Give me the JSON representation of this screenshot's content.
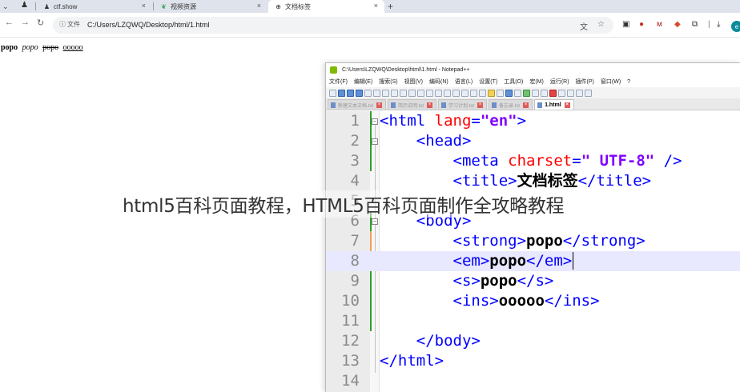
{
  "browser": {
    "tabs": [
      {
        "label": "ctf.show",
        "icon": "user-icon"
      },
      {
        "label": "视频资源",
        "icon": "leaf-icon"
      },
      {
        "label": "文档标签",
        "icon": "globe-icon",
        "active": true
      }
    ],
    "close_glyph": "×",
    "new_tab_glyph": "+",
    "info_chip_label": "文件",
    "url": "C:/Users/LZQWQ/Desktop/html/1.html",
    "avatar_letter": "e"
  },
  "page": {
    "strong_text": "popo",
    "em_text": "popo",
    "s_text": "popo",
    "ins_text": "ooooo"
  },
  "notepad": {
    "title": "C:\\Users\\LZQWQ\\Desktop\\html\\1.html - Notepad++",
    "menu": [
      "文件(F)",
      "编辑(E)",
      "搜索(S)",
      "视图(V)",
      "编码(N)",
      "语言(L)",
      "设置(T)",
      "工具(O)",
      "宏(M)",
      "运行(R)",
      "插件(P)",
      "窗口(W)",
      "?"
    ],
    "file_tabs": [
      {
        "label": "新建文本文档.txt"
      },
      {
        "label": "简历说明.txt"
      },
      {
        "label": "学习计划.txt"
      },
      {
        "label": "备忘录.txt"
      },
      {
        "label": "1.html",
        "active": true
      }
    ],
    "line_numbers": [
      "1",
      "2",
      "3",
      "4",
      "5",
      "6",
      "7",
      "8",
      "9",
      "10",
      "11",
      "12",
      "13",
      "14"
    ],
    "code": {
      "l1_open": "<html ",
      "l1_attr": "lang",
      "l1_eq": "=",
      "l1_val": "\"en\"",
      "l1_close": ">",
      "l2": "<head>",
      "l3_open": "<meta ",
      "l3_attr": "charset",
      "l3_eq": "=",
      "l3_val": "\" UTF-8\"",
      "l3_close": " />",
      "l4_open": "<title>",
      "l4_text": "文档标签",
      "l4_close": "</title>",
      "l6": "<body>",
      "l7_open": "<strong>",
      "l7_text": "popo",
      "l7_close": "</strong>",
      "l8_open": "<em>",
      "l8_text": "popo",
      "l8_close": "</em>",
      "l9_open": "<s>",
      "l9_text": "popo",
      "l9_close": "</s>",
      "l10_open": "<ins>",
      "l10_text": "ooooo",
      "l10_close": "</ins>",
      "l12": "</body>",
      "l13": "</html>"
    }
  },
  "watermark": "html5百科页面教程，HTML5百科页面制作全攻略教程"
}
